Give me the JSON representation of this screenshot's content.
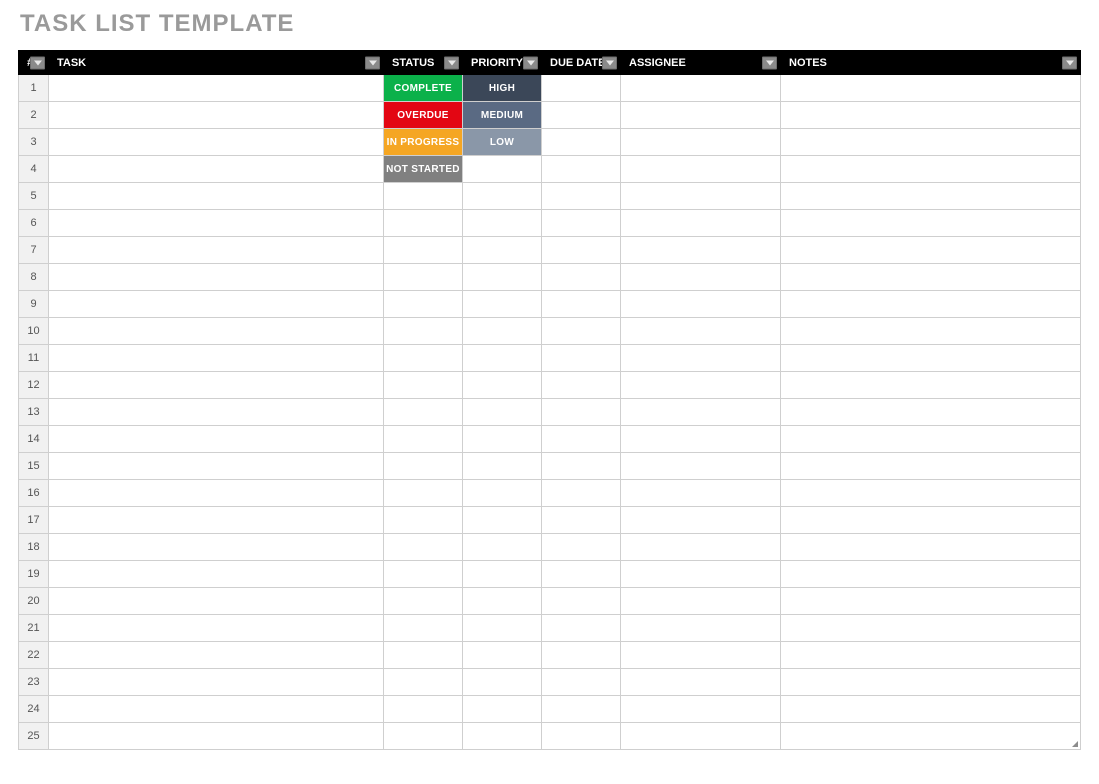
{
  "title": "TASK LIST TEMPLATE",
  "headers": {
    "num": "#",
    "task": "TASK",
    "status": "STATUS",
    "priority": "PRIORITY",
    "due": "DUE DATE",
    "assignee": "ASSIGNEE",
    "notes": "NOTES"
  },
  "status_options": [
    {
      "label": "COMPLETE",
      "bg": "#0bb14a"
    },
    {
      "label": "OVERDUE",
      "bg": "#e30613"
    },
    {
      "label": "IN PROGRESS",
      "bg": "#f5a623"
    },
    {
      "label": "NOT STARTED",
      "bg": "#808080"
    }
  ],
  "priority_options": [
    {
      "label": "HIGH",
      "bg": "#3b4758"
    },
    {
      "label": "MEDIUM",
      "bg": "#5a6a83"
    },
    {
      "label": "LOW",
      "bg": "#8a97a8"
    }
  ],
  "rows": [
    {
      "num": "1",
      "task": "",
      "status_idx": 0,
      "priority_idx": 0,
      "due": "",
      "assignee": "",
      "notes": ""
    },
    {
      "num": "2",
      "task": "",
      "status_idx": 1,
      "priority_idx": 1,
      "due": "",
      "assignee": "",
      "notes": ""
    },
    {
      "num": "3",
      "task": "",
      "status_idx": 2,
      "priority_idx": 2,
      "due": "",
      "assignee": "",
      "notes": ""
    },
    {
      "num": "4",
      "task": "",
      "status_idx": 3,
      "priority_idx": null,
      "due": "",
      "assignee": "",
      "notes": ""
    },
    {
      "num": "5",
      "task": "",
      "status_idx": null,
      "priority_idx": null,
      "due": "",
      "assignee": "",
      "notes": ""
    },
    {
      "num": "6",
      "task": "",
      "status_idx": null,
      "priority_idx": null,
      "due": "",
      "assignee": "",
      "notes": ""
    },
    {
      "num": "7",
      "task": "",
      "status_idx": null,
      "priority_idx": null,
      "due": "",
      "assignee": "",
      "notes": ""
    },
    {
      "num": "8",
      "task": "",
      "status_idx": null,
      "priority_idx": null,
      "due": "",
      "assignee": "",
      "notes": ""
    },
    {
      "num": "9",
      "task": "",
      "status_idx": null,
      "priority_idx": null,
      "due": "",
      "assignee": "",
      "notes": ""
    },
    {
      "num": "10",
      "task": "",
      "status_idx": null,
      "priority_idx": null,
      "due": "",
      "assignee": "",
      "notes": ""
    },
    {
      "num": "11",
      "task": "",
      "status_idx": null,
      "priority_idx": null,
      "due": "",
      "assignee": "",
      "notes": ""
    },
    {
      "num": "12",
      "task": "",
      "status_idx": null,
      "priority_idx": null,
      "due": "",
      "assignee": "",
      "notes": ""
    },
    {
      "num": "13",
      "task": "",
      "status_idx": null,
      "priority_idx": null,
      "due": "",
      "assignee": "",
      "notes": ""
    },
    {
      "num": "14",
      "task": "",
      "status_idx": null,
      "priority_idx": null,
      "due": "",
      "assignee": "",
      "notes": ""
    },
    {
      "num": "15",
      "task": "",
      "status_idx": null,
      "priority_idx": null,
      "due": "",
      "assignee": "",
      "notes": ""
    },
    {
      "num": "16",
      "task": "",
      "status_idx": null,
      "priority_idx": null,
      "due": "",
      "assignee": "",
      "notes": ""
    },
    {
      "num": "17",
      "task": "",
      "status_idx": null,
      "priority_idx": null,
      "due": "",
      "assignee": "",
      "notes": ""
    },
    {
      "num": "18",
      "task": "",
      "status_idx": null,
      "priority_idx": null,
      "due": "",
      "assignee": "",
      "notes": ""
    },
    {
      "num": "19",
      "task": "",
      "status_idx": null,
      "priority_idx": null,
      "due": "",
      "assignee": "",
      "notes": ""
    },
    {
      "num": "20",
      "task": "",
      "status_idx": null,
      "priority_idx": null,
      "due": "",
      "assignee": "",
      "notes": ""
    },
    {
      "num": "21",
      "task": "",
      "status_idx": null,
      "priority_idx": null,
      "due": "",
      "assignee": "",
      "notes": ""
    },
    {
      "num": "22",
      "task": "",
      "status_idx": null,
      "priority_idx": null,
      "due": "",
      "assignee": "",
      "notes": ""
    },
    {
      "num": "23",
      "task": "",
      "status_idx": null,
      "priority_idx": null,
      "due": "",
      "assignee": "",
      "notes": ""
    },
    {
      "num": "24",
      "task": "",
      "status_idx": null,
      "priority_idx": null,
      "due": "",
      "assignee": "",
      "notes": ""
    },
    {
      "num": "25",
      "task": "",
      "status_idx": null,
      "priority_idx": null,
      "due": "",
      "assignee": "",
      "notes": ""
    }
  ]
}
